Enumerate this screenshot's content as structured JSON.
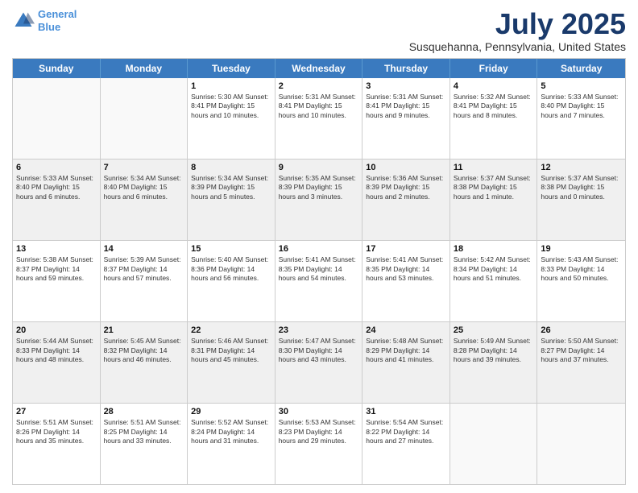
{
  "logo": {
    "line1": "General",
    "line2": "Blue"
  },
  "title": "July 2025",
  "subtitle": "Susquehanna, Pennsylvania, United States",
  "weekdays": [
    "Sunday",
    "Monday",
    "Tuesday",
    "Wednesday",
    "Thursday",
    "Friday",
    "Saturday"
  ],
  "weeks": [
    [
      {
        "day": null,
        "info": null
      },
      {
        "day": null,
        "info": null
      },
      {
        "day": "1",
        "info": "Sunrise: 5:30 AM\nSunset: 8:41 PM\nDaylight: 15 hours\nand 10 minutes."
      },
      {
        "day": "2",
        "info": "Sunrise: 5:31 AM\nSunset: 8:41 PM\nDaylight: 15 hours\nand 10 minutes."
      },
      {
        "day": "3",
        "info": "Sunrise: 5:31 AM\nSunset: 8:41 PM\nDaylight: 15 hours\nand 9 minutes."
      },
      {
        "day": "4",
        "info": "Sunrise: 5:32 AM\nSunset: 8:41 PM\nDaylight: 15 hours\nand 8 minutes."
      },
      {
        "day": "5",
        "info": "Sunrise: 5:33 AM\nSunset: 8:40 PM\nDaylight: 15 hours\nand 7 minutes."
      }
    ],
    [
      {
        "day": "6",
        "info": "Sunrise: 5:33 AM\nSunset: 8:40 PM\nDaylight: 15 hours\nand 6 minutes."
      },
      {
        "day": "7",
        "info": "Sunrise: 5:34 AM\nSunset: 8:40 PM\nDaylight: 15 hours\nand 6 minutes."
      },
      {
        "day": "8",
        "info": "Sunrise: 5:34 AM\nSunset: 8:39 PM\nDaylight: 15 hours\nand 5 minutes."
      },
      {
        "day": "9",
        "info": "Sunrise: 5:35 AM\nSunset: 8:39 PM\nDaylight: 15 hours\nand 3 minutes."
      },
      {
        "day": "10",
        "info": "Sunrise: 5:36 AM\nSunset: 8:39 PM\nDaylight: 15 hours\nand 2 minutes."
      },
      {
        "day": "11",
        "info": "Sunrise: 5:37 AM\nSunset: 8:38 PM\nDaylight: 15 hours\nand 1 minute."
      },
      {
        "day": "12",
        "info": "Sunrise: 5:37 AM\nSunset: 8:38 PM\nDaylight: 15 hours\nand 0 minutes."
      }
    ],
    [
      {
        "day": "13",
        "info": "Sunrise: 5:38 AM\nSunset: 8:37 PM\nDaylight: 14 hours\nand 59 minutes."
      },
      {
        "day": "14",
        "info": "Sunrise: 5:39 AM\nSunset: 8:37 PM\nDaylight: 14 hours\nand 57 minutes."
      },
      {
        "day": "15",
        "info": "Sunrise: 5:40 AM\nSunset: 8:36 PM\nDaylight: 14 hours\nand 56 minutes."
      },
      {
        "day": "16",
        "info": "Sunrise: 5:41 AM\nSunset: 8:35 PM\nDaylight: 14 hours\nand 54 minutes."
      },
      {
        "day": "17",
        "info": "Sunrise: 5:41 AM\nSunset: 8:35 PM\nDaylight: 14 hours\nand 53 minutes."
      },
      {
        "day": "18",
        "info": "Sunrise: 5:42 AM\nSunset: 8:34 PM\nDaylight: 14 hours\nand 51 minutes."
      },
      {
        "day": "19",
        "info": "Sunrise: 5:43 AM\nSunset: 8:33 PM\nDaylight: 14 hours\nand 50 minutes."
      }
    ],
    [
      {
        "day": "20",
        "info": "Sunrise: 5:44 AM\nSunset: 8:33 PM\nDaylight: 14 hours\nand 48 minutes."
      },
      {
        "day": "21",
        "info": "Sunrise: 5:45 AM\nSunset: 8:32 PM\nDaylight: 14 hours\nand 46 minutes."
      },
      {
        "day": "22",
        "info": "Sunrise: 5:46 AM\nSunset: 8:31 PM\nDaylight: 14 hours\nand 45 minutes."
      },
      {
        "day": "23",
        "info": "Sunrise: 5:47 AM\nSunset: 8:30 PM\nDaylight: 14 hours\nand 43 minutes."
      },
      {
        "day": "24",
        "info": "Sunrise: 5:48 AM\nSunset: 8:29 PM\nDaylight: 14 hours\nand 41 minutes."
      },
      {
        "day": "25",
        "info": "Sunrise: 5:49 AM\nSunset: 8:28 PM\nDaylight: 14 hours\nand 39 minutes."
      },
      {
        "day": "26",
        "info": "Sunrise: 5:50 AM\nSunset: 8:27 PM\nDaylight: 14 hours\nand 37 minutes."
      }
    ],
    [
      {
        "day": "27",
        "info": "Sunrise: 5:51 AM\nSunset: 8:26 PM\nDaylight: 14 hours\nand 35 minutes."
      },
      {
        "day": "28",
        "info": "Sunrise: 5:51 AM\nSunset: 8:25 PM\nDaylight: 14 hours\nand 33 minutes."
      },
      {
        "day": "29",
        "info": "Sunrise: 5:52 AM\nSunset: 8:24 PM\nDaylight: 14 hours\nand 31 minutes."
      },
      {
        "day": "30",
        "info": "Sunrise: 5:53 AM\nSunset: 8:23 PM\nDaylight: 14 hours\nand 29 minutes."
      },
      {
        "day": "31",
        "info": "Sunrise: 5:54 AM\nSunset: 8:22 PM\nDaylight: 14 hours\nand 27 minutes."
      },
      {
        "day": null,
        "info": null
      },
      {
        "day": null,
        "info": null
      }
    ]
  ]
}
